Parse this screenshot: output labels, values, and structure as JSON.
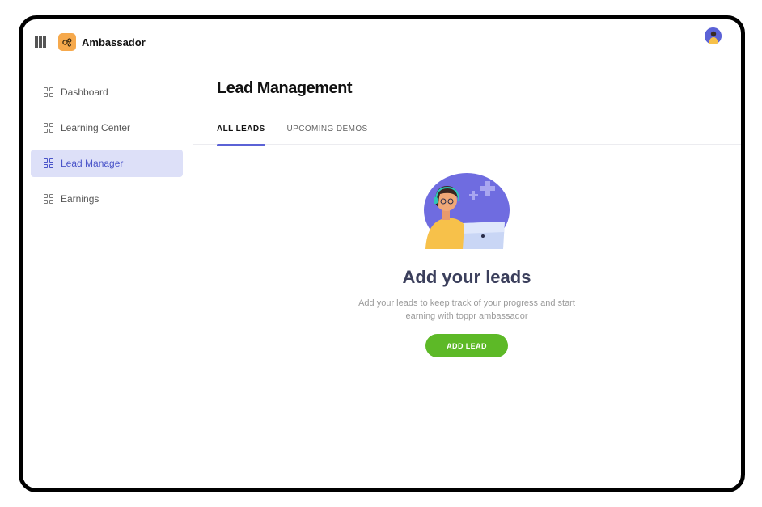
{
  "app": {
    "brand_name": "Ambassador",
    "brand_color": "#f6a94c",
    "accent_color": "#5b62d6"
  },
  "sidebar": {
    "items": [
      {
        "label": "Dashboard",
        "icon": "grid-icon",
        "active": false
      },
      {
        "label": "Learning Center",
        "icon": "grid-icon",
        "active": false
      },
      {
        "label": "Lead Manager",
        "icon": "grid-icon",
        "active": true
      },
      {
        "label": "Earnings",
        "icon": "grid-icon",
        "active": false
      }
    ]
  },
  "header": {
    "page_title": "Lead Management",
    "avatar_icon": "user-avatar"
  },
  "tabs": [
    {
      "label": "ALL LEADS",
      "active": true
    },
    {
      "label": "UPCOMING DEMOS",
      "active": false
    }
  ],
  "empty_state": {
    "title": "Add your leads",
    "description": "Add your leads to keep track of your progress and start earning with toppr ambassador",
    "button_label": "ADD LEAD",
    "button_color": "#5db927",
    "illustration": "support-agent-illustration"
  }
}
